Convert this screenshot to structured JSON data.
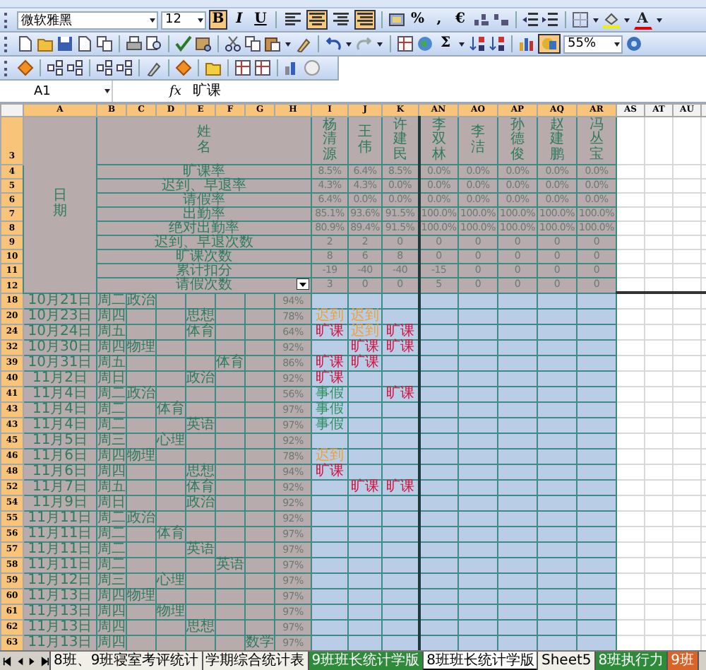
{
  "format_toolbar": {
    "font": "微软雅黑",
    "size": "12",
    "style_buttons": [
      {
        "label": "B",
        "on": true
      },
      {
        "label": "I",
        "on": false
      },
      {
        "label": "U",
        "on": false
      }
    ],
    "align_buttons": [
      {
        "on": false
      },
      {
        "on": true
      },
      {
        "on": false
      },
      {
        "on": true
      }
    ],
    "number_buttons": [
      "%",
      ",",
      "€"
    ],
    "font_color": "A"
  },
  "standard_toolbar": {
    "sigma": "Σ",
    "drawing_on": true,
    "zoom": "55%"
  },
  "formula_bar": {
    "name_box": "A1",
    "fx": "fx",
    "formula": "旷课"
  },
  "columns": [
    "A",
    "B",
    "C",
    "D",
    "E",
    "F",
    "G",
    "H",
    "I",
    "J",
    "K",
    "AN",
    "AO",
    "AP",
    "AQ",
    "AR",
    "AS",
    "AT",
    "AU"
  ],
  "summary": {
    "header_row": "3",
    "date_label": "日期",
    "name_label": "姓名",
    "students": [
      "杨清源",
      "王伟",
      "许建民",
      "李双林",
      "李洁",
      "孙德俊",
      "赵建鹏",
      "冯丛宝"
    ],
    "rows": [
      {
        "row": "4",
        "label": "旷课率",
        "filter": false,
        "values": [
          "8.5%",
          "6.4%",
          "8.5%",
          "0.0%",
          "0.0%",
          "0.0%",
          "0.0%",
          "0.0%"
        ]
      },
      {
        "row": "5",
        "label": "迟到、早退率",
        "filter": false,
        "values": [
          "4.3%",
          "4.3%",
          "0.0%",
          "0.0%",
          "0.0%",
          "0.0%",
          "0.0%",
          "0.0%"
        ]
      },
      {
        "row": "6",
        "label": "请假率",
        "filter": false,
        "values": [
          "6.4%",
          "0.0%",
          "0.0%",
          "0.0%",
          "0.0%",
          "0.0%",
          "0.0%",
          "0.0%"
        ]
      },
      {
        "row": "7",
        "label": "出勤率",
        "filter": false,
        "values": [
          "85.1%",
          "93.6%",
          "91.5%",
          "100.0%",
          "100.0%",
          "100.0%",
          "100.0%",
          "100.0%"
        ]
      },
      {
        "row": "8",
        "label": "绝对出勤率",
        "filter": false,
        "values": [
          "80.9%",
          "89.4%",
          "91.5%",
          "100.0%",
          "100.0%",
          "100.0%",
          "100.0%",
          "100.0%"
        ]
      },
      {
        "row": "9",
        "label": "迟到、早退次数",
        "filter": false,
        "values": [
          "2",
          "2",
          "0",
          "0",
          "0",
          "0",
          "0",
          "0"
        ]
      },
      {
        "row": "10",
        "label": "旷课次数",
        "filter": false,
        "values": [
          "8",
          "6",
          "8",
          "0",
          "0",
          "0",
          "0",
          "0"
        ]
      },
      {
        "row": "11",
        "label": "累计扣分",
        "filter": false,
        "values": [
          "-19",
          "-40",
          "-40",
          "-15",
          "0",
          "0",
          "0",
          "0"
        ]
      },
      {
        "row": "12",
        "label": "请假次数",
        "filter": true,
        "values": [
          "3",
          "0",
          "0",
          "5",
          "0",
          "0",
          "0",
          "0"
        ]
      }
    ]
  },
  "rows": [
    {
      "row": "18",
      "date": "10月21日",
      "weekday": "周二",
      "periods": {
        "C": "政治"
      },
      "rate": "94%",
      "marks": {}
    },
    {
      "row": "20",
      "date": "10月23日",
      "weekday": "周四",
      "periods": {
        "E": "思想"
      },
      "rate": "78%",
      "marks": {
        "I": {
          "text": "迟到",
          "kind": "late"
        },
        "J": {
          "text": "迟到",
          "kind": "late"
        }
      }
    },
    {
      "row": "24",
      "date": "10月24日",
      "weekday": "周五",
      "periods": {
        "E": "体育"
      },
      "rate": "64%",
      "marks": {
        "I": {
          "text": "旷课",
          "kind": "absent"
        },
        "J": {
          "text": "迟到",
          "kind": "late"
        },
        "K": {
          "text": "旷课",
          "kind": "absent"
        }
      }
    },
    {
      "row": "32",
      "date": "10月30日",
      "weekday": "周四",
      "periods": {
        "C": "物理"
      },
      "rate": "92%",
      "marks": {
        "J": {
          "text": "旷课",
          "kind": "absent"
        },
        "K": {
          "text": "旷课",
          "kind": "absent"
        }
      }
    },
    {
      "row": "39",
      "date": "10月31日",
      "weekday": "周五",
      "periods": {
        "F": "体育"
      },
      "rate": "86%",
      "marks": {
        "I": {
          "text": "旷课",
          "kind": "absent"
        },
        "J": {
          "text": "旷课",
          "kind": "absent"
        }
      }
    },
    {
      "row": "40",
      "date": "11月2日",
      "weekday": "周日",
      "periods": {
        "E": "政治"
      },
      "rate": "92%",
      "marks": {
        "I": {
          "text": "旷课",
          "kind": "absent"
        }
      }
    },
    {
      "row": "41",
      "date": "11月4日",
      "weekday": "周二",
      "periods": {
        "C": "政治"
      },
      "rate": "56%",
      "marks": {
        "I": {
          "text": "事假",
          "kind": "leave"
        },
        "K": {
          "text": "旷课",
          "kind": "absent"
        }
      }
    },
    {
      "row": "43",
      "date": "11月4日",
      "weekday": "周二",
      "periods": {
        "D": "体育"
      },
      "rate": "97%",
      "marks": {
        "I": {
          "text": "事假",
          "kind": "leave"
        }
      }
    },
    {
      "row": "43",
      "date": "11月4日",
      "weekday": "周二",
      "periods": {
        "E": "英语"
      },
      "rate": "97%",
      "marks": {
        "I": {
          "text": "事假",
          "kind": "leave"
        }
      }
    },
    {
      "row": "45",
      "date": "11月5日",
      "weekday": "周三",
      "periods": {
        "D": "心理"
      },
      "rate": "92%",
      "marks": {}
    },
    {
      "row": "46",
      "date": "11月6日",
      "weekday": "周四",
      "periods": {
        "C": "物理"
      },
      "rate": "78%",
      "marks": {
        "I": {
          "text": "迟到",
          "kind": "late"
        }
      }
    },
    {
      "row": "48",
      "date": "11月6日",
      "weekday": "周四",
      "periods": {
        "E": "思想"
      },
      "rate": "94%",
      "marks": {
        "I": {
          "text": "旷课",
          "kind": "absent"
        }
      }
    },
    {
      "row": "52",
      "date": "11月7日",
      "weekday": "周五",
      "periods": {
        "E": "体育"
      },
      "rate": "92%",
      "marks": {
        "J": {
          "text": "旷课",
          "kind": "absent"
        },
        "K": {
          "text": "旷课",
          "kind": "absent"
        }
      }
    },
    {
      "row": "54",
      "date": "11月9日",
      "weekday": "周日",
      "periods": {
        "E": "政治"
      },
      "rate": "92%",
      "marks": {}
    },
    {
      "row": "55",
      "date": "11月11日",
      "weekday": "周二",
      "periods": {
        "C": "政治"
      },
      "rate": "92%",
      "marks": {}
    },
    {
      "row": "56",
      "date": "11月11日",
      "weekday": "周二",
      "periods": {
        "D": "体育"
      },
      "rate": "97%",
      "marks": {}
    },
    {
      "row": "57",
      "date": "11月11日",
      "weekday": "周二",
      "periods": {
        "E": "英语"
      },
      "rate": "97%",
      "marks": {}
    },
    {
      "row": "58",
      "date": "11月11日",
      "weekday": "周二",
      "periods": {
        "F": "英语"
      },
      "rate": "97%",
      "marks": {}
    },
    {
      "row": "59",
      "date": "11月12日",
      "weekday": "周三",
      "periods": {
        "D": "心理"
      },
      "rate": "97%",
      "marks": {}
    },
    {
      "row": "60",
      "date": "11月13日",
      "weekday": "周四",
      "periods": {
        "C": "物理"
      },
      "rate": "97%",
      "marks": {}
    },
    {
      "row": "61",
      "date": "11月13日",
      "weekday": "周四",
      "periods": {
        "D": "物理"
      },
      "rate": "97%",
      "marks": {}
    },
    {
      "row": "62",
      "date": "11月13日",
      "weekday": "周四",
      "periods": {
        "E": "思想"
      },
      "rate": "97%",
      "marks": {}
    },
    {
      "row": "63",
      "date": "11月13日",
      "weekday": "周四",
      "periods": {
        "G": "数学"
      },
      "rate": "97%",
      "marks": {}
    }
  ],
  "sheet_tabs": [
    {
      "label": "8班、9班寝室考评统计",
      "selected": false
    },
    {
      "label": "学期综合统计表",
      "selected": false
    },
    {
      "label": "9班班长统计学版",
      "selected": false,
      "color": "#2e8b3a"
    },
    {
      "label": "8班班长统计学版",
      "selected": true
    },
    {
      "label": "Sheet5",
      "selected": false
    },
    {
      "label": "8班执行力",
      "selected": false,
      "color": "#2e8b3a"
    },
    {
      "label": "9班",
      "selected": false,
      "color": "#d8642a"
    }
  ]
}
